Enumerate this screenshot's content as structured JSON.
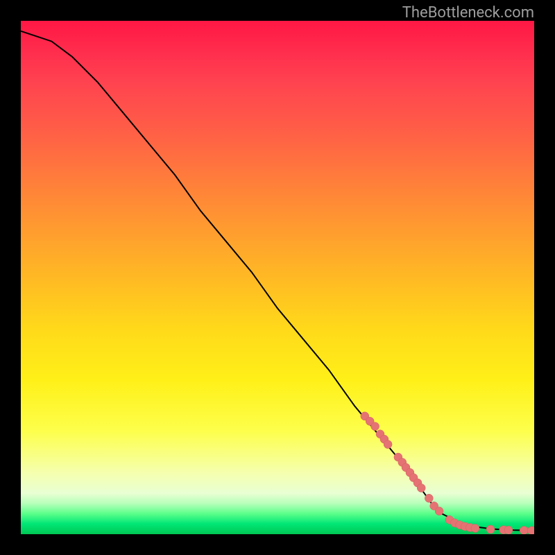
{
  "attribution": "TheBottleneck.com",
  "chart_data": {
    "type": "line",
    "title": "",
    "xlabel": "",
    "ylabel": "",
    "xlim": [
      0,
      100
    ],
    "ylim": [
      0,
      100
    ],
    "grid": false,
    "legend": false,
    "series": [
      {
        "name": "curve",
        "x": [
          0,
          3,
          6,
          10,
          15,
          20,
          25,
          30,
          35,
          40,
          45,
          50,
          55,
          60,
          65,
          70,
          75,
          80,
          82,
          85,
          88,
          92,
          96,
          100
        ],
        "y": [
          98,
          97,
          96,
          93,
          88,
          82,
          76,
          70,
          63,
          57,
          51,
          44,
          38,
          32,
          25,
          19,
          13,
          6,
          4,
          2.5,
          1.5,
          1.0,
          0.8,
          0.7
        ]
      }
    ],
    "scatter_points": {
      "name": "highlighted-points",
      "color": "#e57373",
      "points": [
        {
          "x": 67,
          "y": 23
        },
        {
          "x": 68,
          "y": 22
        },
        {
          "x": 69,
          "y": 21
        },
        {
          "x": 70,
          "y": 19.5
        },
        {
          "x": 70.8,
          "y": 18.5
        },
        {
          "x": 71.5,
          "y": 17.5
        },
        {
          "x": 73.5,
          "y": 15
        },
        {
          "x": 74.3,
          "y": 14
        },
        {
          "x": 75,
          "y": 13
        },
        {
          "x": 75.8,
          "y": 12
        },
        {
          "x": 76.5,
          "y": 11
        },
        {
          "x": 77.3,
          "y": 10
        },
        {
          "x": 78,
          "y": 9
        },
        {
          "x": 79.5,
          "y": 7
        },
        {
          "x": 80.5,
          "y": 5.5
        },
        {
          "x": 81.5,
          "y": 4.5
        },
        {
          "x": 83.5,
          "y": 2.8
        },
        {
          "x": 84.5,
          "y": 2.2
        },
        {
          "x": 85.5,
          "y": 1.8
        },
        {
          "x": 86.5,
          "y": 1.5
        },
        {
          "x": 87.5,
          "y": 1.3
        },
        {
          "x": 88.5,
          "y": 1.15
        },
        {
          "x": 91.5,
          "y": 0.95
        },
        {
          "x": 94,
          "y": 0.85
        },
        {
          "x": 95,
          "y": 0.8
        },
        {
          "x": 98,
          "y": 0.75
        },
        {
          "x": 99.5,
          "y": 0.7
        }
      ]
    }
  }
}
